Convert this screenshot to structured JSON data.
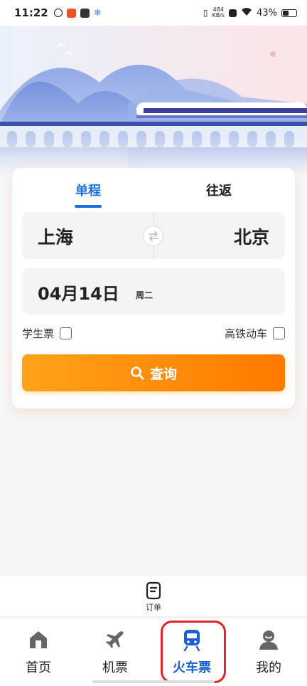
{
  "status_bar": {
    "time": "11:22",
    "net_speed_value": "484",
    "net_speed_unit": "KB/s",
    "battery": "43%"
  },
  "booking": {
    "tabs": [
      {
        "label": "单程",
        "active": true
      },
      {
        "label": "往返",
        "active": false
      }
    ],
    "from_city": "上海",
    "to_city": "北京",
    "date": "04月14日",
    "weekday": "周二",
    "student_ticket_label": "学生票",
    "student_ticket_checked": false,
    "hsr_label": "高铁动车",
    "hsr_checked": false,
    "search_label": "查询"
  },
  "orders": {
    "label": "订单",
    "icon": "orders-icon"
  },
  "tabbar": {
    "items": [
      {
        "label": "首页",
        "icon": "home-icon",
        "active": false
      },
      {
        "label": "机票",
        "icon": "airplane-icon",
        "active": false
      },
      {
        "label": "火车票",
        "icon": "train-icon",
        "active": true
      },
      {
        "label": "我的",
        "icon": "profile-icon",
        "active": false
      }
    ]
  },
  "colors": {
    "accent_blue": "#1a6fe0",
    "search_orange": "#ff8a0a",
    "highlight_red": "#e0242c"
  }
}
